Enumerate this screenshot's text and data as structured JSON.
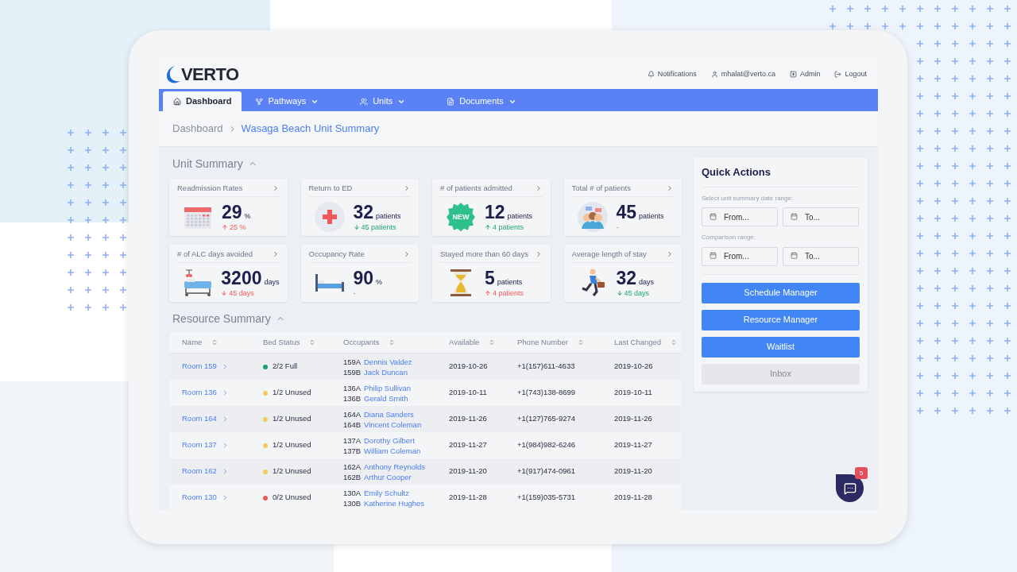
{
  "header": {
    "logo": "VERTO",
    "links": [
      {
        "kind": "bell",
        "label": "Notifications"
      },
      {
        "kind": "user",
        "label": "mhalat@verto.ca"
      },
      {
        "kind": "admin",
        "label": "Admin"
      },
      {
        "kind": "logout",
        "label": "Logout"
      }
    ]
  },
  "nav": [
    {
      "kind": "home",
      "label": "Dashboard",
      "selected": true,
      "dropdown": false
    },
    {
      "kind": "pathways",
      "label": "Pathways",
      "selected": false,
      "dropdown": true
    },
    {
      "kind": "units",
      "label": "Units",
      "selected": false,
      "dropdown": true
    },
    {
      "kind": "documents",
      "label": "Documents",
      "selected": false,
      "dropdown": true
    }
  ],
  "breadcrumb": [
    "Dashboard",
    "Wasaga Beach Unit Summary"
  ],
  "unit_summary": {
    "title": "Unit Summary",
    "expanded": true,
    "cards": [
      {
        "title": "Readmission Rates",
        "kind": "calendar",
        "value": "29",
        "unit": "%",
        "change": "25 %",
        "rising": true,
        "falling": false,
        "favorable": false
      },
      {
        "title": "Return to ED",
        "kind": "cross",
        "value": "32",
        "unit": "patients",
        "change": "45 patients",
        "rising": false,
        "falling": true,
        "favorable": true
      },
      {
        "title": "# of patients admitted",
        "kind": "new",
        "badge": "NEW",
        "value": "12",
        "unit": "patients",
        "change": "4 patients",
        "rising": true,
        "falling": false,
        "favorable": true
      },
      {
        "title": "Total # of patients",
        "kind": "people",
        "value": "45",
        "unit": "patients",
        "change": "-"
      },
      {
        "title": "# of ALC days avoided",
        "kind": "hospital-bed",
        "value": "3200",
        "unit": "days",
        "change": "45 days",
        "rising": false,
        "falling": true,
        "favorable": false
      },
      {
        "title": "Occupancy Rate",
        "kind": "bed",
        "value": "90",
        "unit": "%",
        "change": "-"
      },
      {
        "title": "Stayed more than 60 days",
        "kind": "hourglass",
        "value": "5",
        "unit": "patients",
        "change": "4 patients",
        "rising": true,
        "falling": false,
        "favorable": false
      },
      {
        "title": "Average length of stay",
        "kind": "runner",
        "value": "32",
        "unit": "days",
        "change": "45 days",
        "rising": false,
        "falling": true,
        "favorable": true
      }
    ]
  },
  "resource_summary": {
    "title": "Resource Summary",
    "expanded": true,
    "table": {
      "columns": [
        "Name",
        "Bed Status",
        "Occupants",
        "Available",
        "Phone Number",
        "Last Changed"
      ],
      "rows": [
        {
          "name": "Room 159",
          "status": "2/2 Full",
          "color": "#1e9e6a",
          "occupants": [
            {
              "bed": "159A",
              "name": "Dennis Valdez"
            },
            {
              "bed": "159B",
              "name": "Jack Duncan"
            }
          ],
          "available": "2019-10-26",
          "phone": "+1(157)611-4633",
          "last_changed": "2019-10-26"
        },
        {
          "name": "Room 136",
          "status": "1/2 Unused",
          "color": "#f5cc5c",
          "occupants": [
            {
              "bed": "136A",
              "name": "Philip Sullivan"
            },
            {
              "bed": "136B",
              "name": "Gerald Smith"
            }
          ],
          "available": "2019-10-11",
          "phone": "+1(743)138-8699",
          "last_changed": "2019-10-11"
        },
        {
          "name": "Room 164",
          "status": "1/2 Unused",
          "color": "#f5cc5c",
          "occupants": [
            {
              "bed": "164A",
              "name": "Diana Sanders"
            },
            {
              "bed": "164B",
              "name": "Vincent Coleman"
            }
          ],
          "available": "2019-11-26",
          "phone": "+1(127)765-9274",
          "last_changed": "2019-11-26"
        },
        {
          "name": "Room 137",
          "status": "1/2 Unused",
          "color": "#f5cc5c",
          "occupants": [
            {
              "bed": "137A",
              "name": "Dorothy Gilbert"
            },
            {
              "bed": "137B",
              "name": "William Coleman"
            }
          ],
          "available": "2019-11-27",
          "phone": "+1(984)982-6246",
          "last_changed": "2019-11-27"
        },
        {
          "name": "Room 162",
          "status": "1/2 Unused",
          "color": "#f5cc5c",
          "occupants": [
            {
              "bed": "162A",
              "name": "Anthony Reynolds"
            },
            {
              "bed": "162B",
              "name": "Arthur Cooper"
            }
          ],
          "available": "2019-11-20",
          "phone": "+1(917)474-0961",
          "last_changed": "2019-11-20"
        },
        {
          "name": "Room 130",
          "status": "0/2 Unused",
          "color": "#e85a5a",
          "occupants": [
            {
              "bed": "130A",
              "name": "Emily Schultz"
            },
            {
              "bed": "130B",
              "name": "Katherine Hughes"
            }
          ],
          "available": "2019-11-28",
          "phone": "+1(159)035-5731",
          "last_changed": "2019-11-28"
        }
      ]
    }
  },
  "quick_actions": {
    "title": "Quick Actions",
    "ranges": [
      {
        "label": "Select unit summary date range:",
        "from_placeholder": "From...",
        "to_placeholder": "To..."
      },
      {
        "label": "Comparison range:",
        "from_placeholder": "From...",
        "to_placeholder": "To..."
      }
    ],
    "buttons": [
      {
        "label": "Schedule Manager",
        "disabled": false
      },
      {
        "label": "Resource Manager",
        "disabled": false
      },
      {
        "label": "Waitlist",
        "disabled": false
      },
      {
        "label": "Inbox",
        "disabled": true
      }
    ]
  },
  "chat": {
    "badge": "5"
  }
}
